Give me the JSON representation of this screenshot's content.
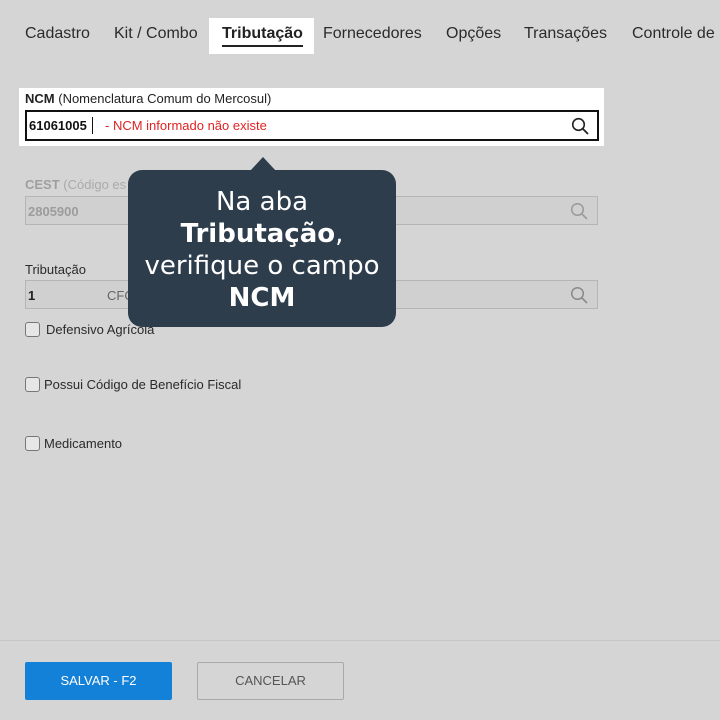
{
  "tabs": [
    {
      "label": "Cadastro"
    },
    {
      "label": "Kit / Combo"
    },
    {
      "label": "Tributação",
      "active": true
    },
    {
      "label": "Fornecedores"
    },
    {
      "label": "Opções"
    },
    {
      "label": "Transações"
    },
    {
      "label": "Controle de"
    }
  ],
  "ncm": {
    "label_bold": "NCM",
    "label_rest": "(Nomenclatura Comum do Mercosul)",
    "value": "61061005",
    "error": "- NCM informado não existe",
    "icon": "search-icon"
  },
  "cest": {
    "label_bold": "CEST",
    "label_rest": "(Código es",
    "value": "2805900",
    "icon": "search-icon"
  },
  "tributacao": {
    "label": "Tributação",
    "value": "1",
    "cfop_fragment": "CFO",
    "icon": "search-icon"
  },
  "checkboxes": [
    {
      "label": "Defensivo Agrícola",
      "checked": false
    },
    {
      "label": "Possui Código de Benefício Fiscal",
      "checked": false
    },
    {
      "label": "Medicamento",
      "checked": false
    }
  ],
  "tooltip": {
    "line1": "Na aba",
    "line2_bold": "Tributação",
    "line2_rest": ",",
    "line3": "verifique o campo",
    "line4_bold": "NCM"
  },
  "footer": {
    "save_label": "SALVAR - F2",
    "cancel_label": "CANCELAR"
  },
  "colors": {
    "overlay_bg": "#d5d5d5",
    "tooltip_bg": "#2e3d4c",
    "error": "#e02323",
    "primary": "#1481d8"
  }
}
